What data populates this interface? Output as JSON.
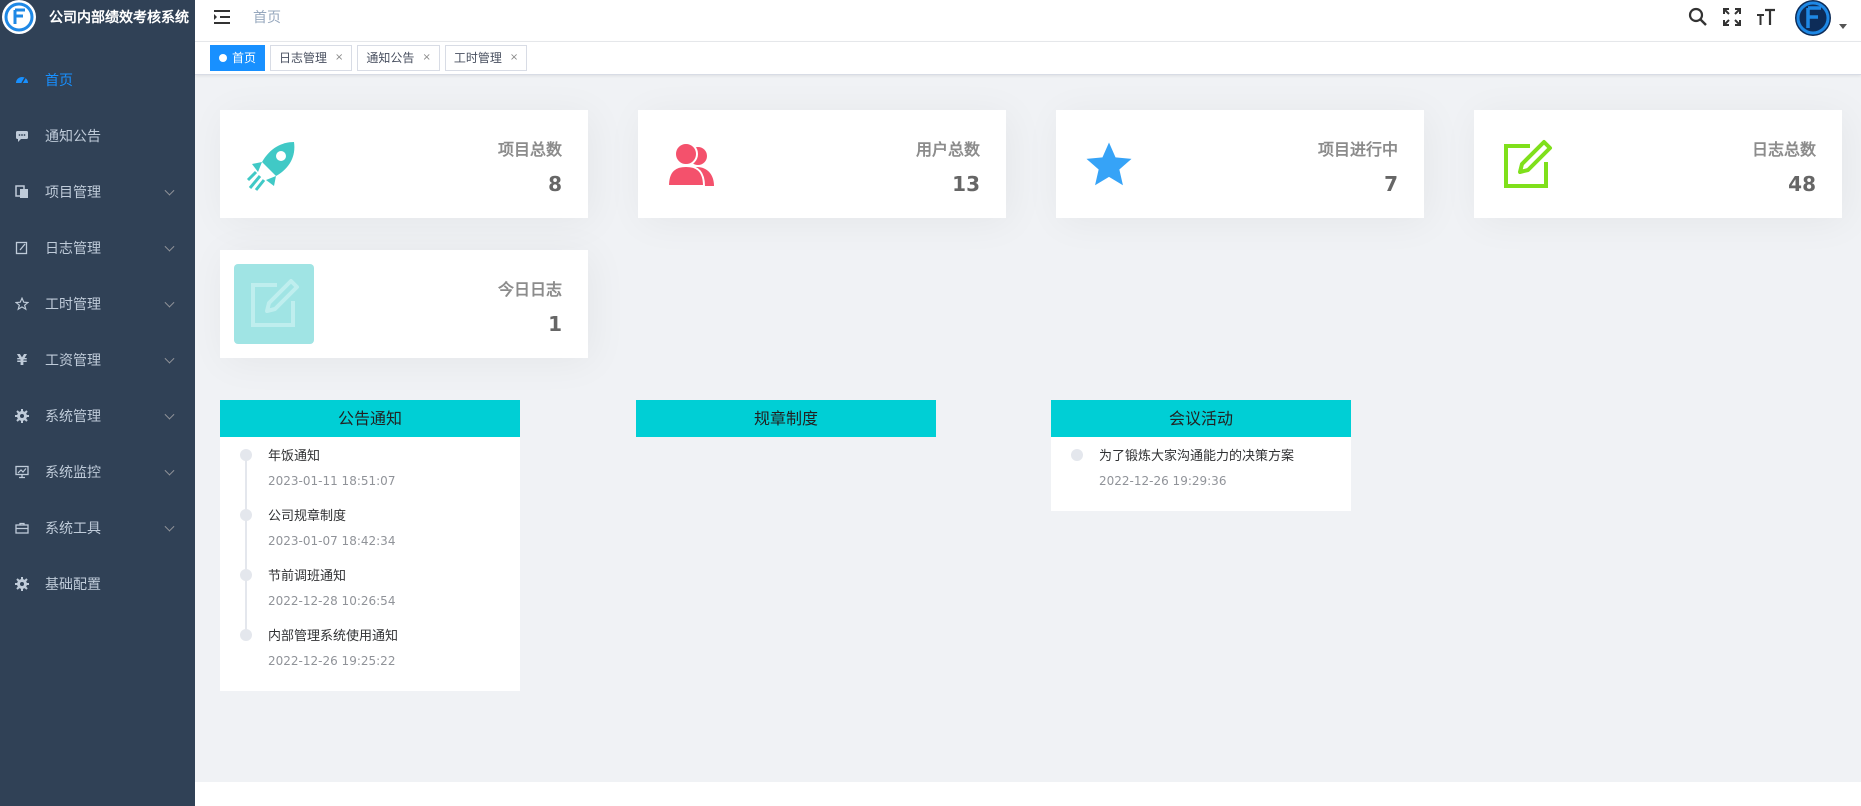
{
  "app": {
    "title": "公司内部绩效考核系统"
  },
  "sidebar": {
    "items": [
      {
        "label": "首页",
        "icon": "dashboard-icon",
        "active": true,
        "has_children": false
      },
      {
        "label": "通知公告",
        "icon": "message-icon",
        "has_children": false
      },
      {
        "label": "项目管理",
        "icon": "documents-icon",
        "has_children": true
      },
      {
        "label": "日志管理",
        "icon": "edit-log-icon",
        "has_children": true
      },
      {
        "label": "工时管理",
        "icon": "star-outline-icon",
        "has_children": true
      },
      {
        "label": "工资管理",
        "icon": "yen-icon",
        "has_children": true
      },
      {
        "label": "系统管理",
        "icon": "gear-icon",
        "has_children": true
      },
      {
        "label": "系统监控",
        "icon": "monitor-icon",
        "has_children": true
      },
      {
        "label": "系统工具",
        "icon": "toolbox-icon",
        "has_children": true
      },
      {
        "label": "基础配置",
        "icon": "gear-icon",
        "has_children": false
      }
    ]
  },
  "navbar": {
    "breadcrumb": "首页",
    "icons": [
      "search-icon",
      "fullscreen-icon",
      "font-size-icon"
    ]
  },
  "tags": [
    {
      "label": "首页",
      "active": true
    },
    {
      "label": "日志管理",
      "active": false
    },
    {
      "label": "通知公告",
      "active": false
    },
    {
      "label": "工时管理",
      "active": false
    }
  ],
  "stats": [
    {
      "label": "项目总数",
      "value": "8",
      "icon": "rocket-icon",
      "color": "#40c9c6"
    },
    {
      "label": "用户总数",
      "value": "13",
      "icon": "users-icon",
      "color": "#f4516c"
    },
    {
      "label": "项目进行中",
      "value": "7",
      "icon": "star-icon",
      "color": "#36a3f7"
    },
    {
      "label": "日志总数",
      "value": "48",
      "icon": "edit-icon",
      "color": "#7fe01b"
    },
    {
      "label": "今日日志",
      "value": "1",
      "icon": "edit-box-icon",
      "color": "#a0e4e4"
    }
  ],
  "cards": {
    "notice": {
      "title": "公告通知",
      "items": [
        {
          "title": "年饭通知",
          "time": "2023-01-11 18:51:07"
        },
        {
          "title": "公司规章制度",
          "time": "2023-01-07 18:42:34"
        },
        {
          "title": "节前调班通知",
          "time": "2022-12-28 10:26:54"
        },
        {
          "title": "内部管理系统使用通知",
          "time": "2022-12-26 19:25:22"
        }
      ]
    },
    "rules": {
      "title": "规章制度",
      "items": []
    },
    "meeting": {
      "title": "会议活动",
      "items": [
        {
          "title": "为了锻炼大家沟通能力的决策方案",
          "time": "2022-12-26 19:29:36"
        }
      ]
    }
  },
  "colors": {
    "sidebar_bg": "#304156",
    "accent": "#1890ff",
    "card_header": "#00cfd5"
  }
}
